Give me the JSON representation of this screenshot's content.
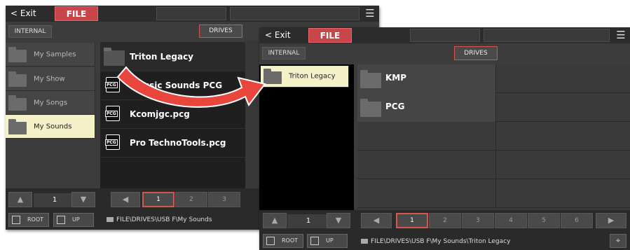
{
  "left_panel": {
    "exit_label": "< Exit",
    "file_tab": "FILE",
    "internal_label": "INTERNAL",
    "drives_label": "DRIVES",
    "side_items": [
      {
        "label": "My Samples"
      },
      {
        "label": "My Show"
      },
      {
        "label": "My Songs"
      },
      {
        "label": "My Sounds"
      }
    ],
    "files": [
      {
        "label": "Triton Legacy",
        "icon": "folder-icon"
      },
      {
        "label": "Classic Sounds PCG",
        "icon": "pcg-file-icon"
      },
      {
        "label": "Kcomjgc.pcg",
        "icon": "pcg-file-icon"
      },
      {
        "label": "Pro TechnoTools.pcg",
        "icon": "pcg-file-icon"
      }
    ],
    "page_num": "1",
    "pages": [
      "1",
      "2",
      "3"
    ],
    "root_label": "ROOT",
    "up_label": "UP",
    "path": "FILE\\DRIVES\\USB F\\My Sounds"
  },
  "right_panel": {
    "exit_label": "< Exit",
    "file_tab": "FILE",
    "internal_label": "INTERNAL",
    "drives_label": "DRIVES",
    "side_selected": "Triton Legacy",
    "folders": [
      {
        "label": "KMP"
      },
      {
        "label": "PCG"
      }
    ],
    "page_num": "1",
    "pages": [
      "1",
      "2",
      "3",
      "4",
      "5",
      "6"
    ],
    "root_label": "ROOT",
    "up_label": "UP",
    "path": "FILE\\DRIVES\\USB F\\My Sounds\\Triton Legacy"
  },
  "pcg_badge": "PCG",
  "colors": {
    "accent": "#d9534f",
    "file_tab": "#c8454a",
    "selected_row": "#f4f0c8",
    "panel_bg": "#3c3c3c",
    "arrow": "#e8453c"
  }
}
